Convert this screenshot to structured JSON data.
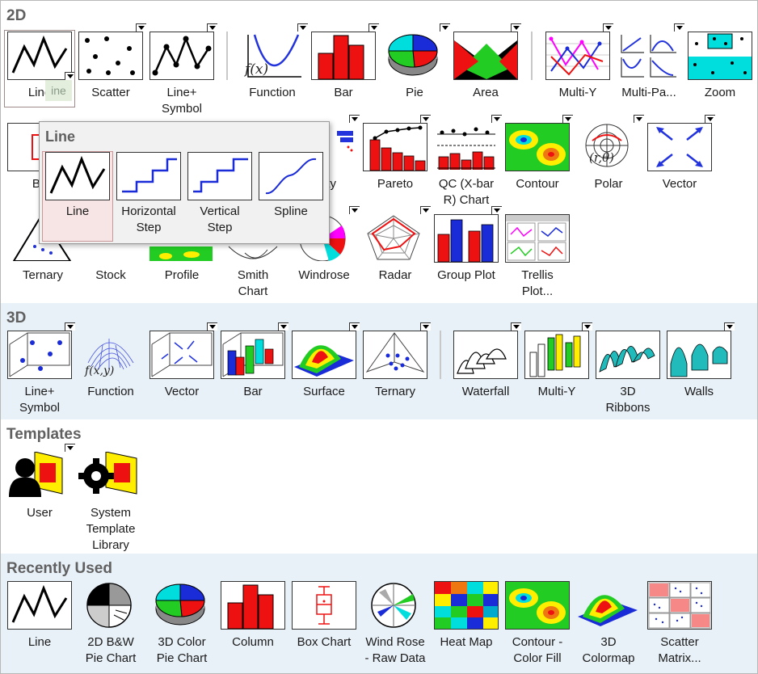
{
  "sections": {
    "s2d": "2D",
    "s3d": "3D",
    "templates": "Templates",
    "recent": "Recently Used"
  },
  "row1": [
    "Line",
    "Scatter",
    "Line+\nSymbol",
    "Function",
    "Bar",
    "Pie",
    "Area",
    "Multi-Y",
    "Multi-Pa...",
    "Zoom"
  ],
  "row2": [
    "Bo",
    "bility",
    "Pareto",
    "QC (X-bar\nR) Chart",
    "Contour",
    "Polar",
    "Vector"
  ],
  "row3": [
    "Ternary",
    "Stock",
    "Profile",
    "Smith\nChart",
    "Windrose",
    "Radar",
    "Group Plot",
    "Trellis\nPlot..."
  ],
  "row3d": [
    "Line+\nSymbol",
    "Function",
    "Vector",
    "Bar",
    "Surface",
    "Ternary",
    "Waterfall",
    "Multi-Y",
    "3D\nRibbons",
    "Walls"
  ],
  "templates": [
    "User",
    "System\nTemplate\nLibrary"
  ],
  "recent": [
    "Line",
    "2D B&W\nPie Chart",
    "3D Color\nPie Chart",
    "Column",
    "Box Chart",
    "Wind Rose\n- Raw Data",
    "Heat Map",
    "Contour -\nColor Fill",
    "3D\nColormap",
    "Scatter\nMatrix..."
  ],
  "popup": {
    "title": "Line",
    "items": [
      "Line",
      "Horizontal\nStep",
      "Vertical\nStep",
      "Spline"
    ]
  },
  "ghost": "ine",
  "function_text": "f(x)",
  "function3d_text": "f(x,y)",
  "polar_text": "(r,θ)",
  "colors": {
    "red": "#ee1111",
    "blue": "#1a2bd8",
    "green": "#22cc22",
    "yellow": "#ffee00",
    "cyan": "#00dddd",
    "magenta": "#ff00ff",
    "sectionBlue": "#e9f1f8"
  }
}
